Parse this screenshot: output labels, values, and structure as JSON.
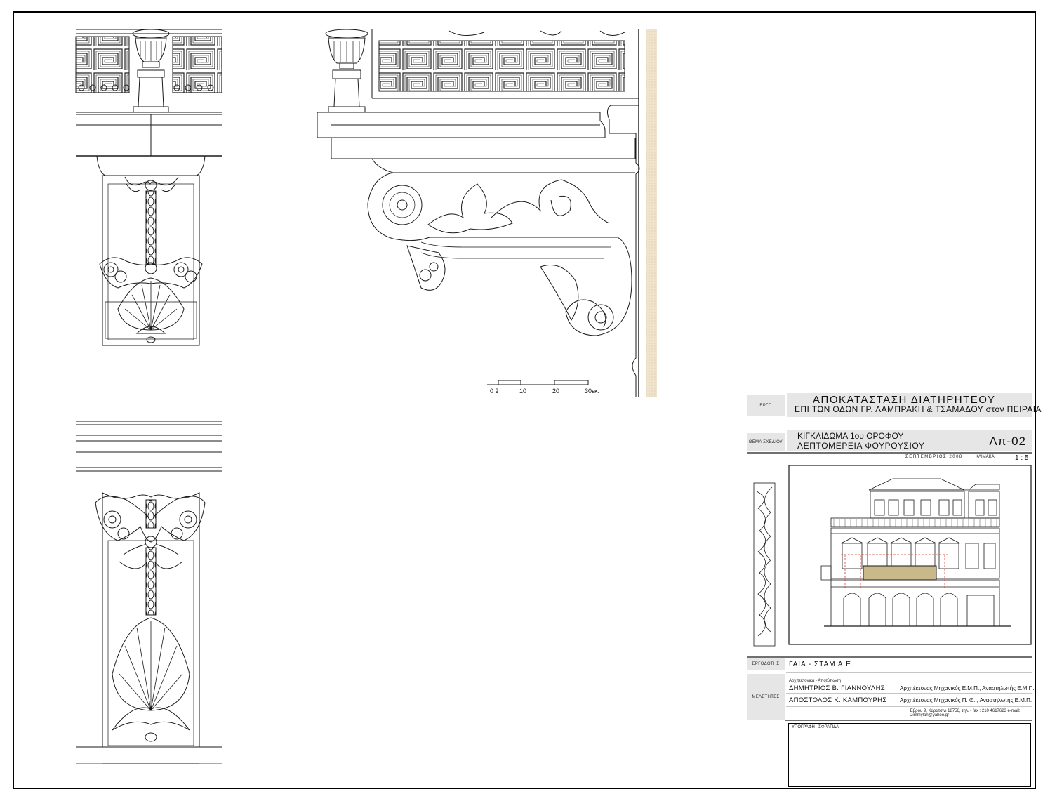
{
  "scale_bar": {
    "labels": [
      "0 2",
      "10",
      "20",
      "30εκ."
    ]
  },
  "title_block": {
    "project_label": "ΕΡΓΟ",
    "project_line1": "ΑΠΟΚΑΤΑΣΤΑΣΗ ΔΙΑΤΗΡΗΤΕΟΥ",
    "project_line2": "ΕΠΙ ΤΩΝ ΟΔΩΝ ΓΡ. ΛΑΜΠΡΑΚΗ & ΤΣΑΜΑΔΟΥ στον ΠΕΙΡΑΙΑ",
    "subject_label": "ΘΕΜΑ ΣΧΕΔΙΟΥ",
    "subject_line1": "ΚΙΓΚΛΙΔΩΜΑ 1ου ΟΡΟΦΟΥ",
    "subject_line2": "ΛΕΠΤΟΜΕΡΕΙΑ ΦΟΥΡΟΥΣΙΟΥ",
    "drawing_code": "Λπ-02",
    "date": "ΣΕΠΤΕΜΒΡΙΟΣ 2008",
    "scale_label": "ΚΛΙΜΑΚΑ",
    "scale_value": "1 : 5",
    "client_label": "ΕΡΓΟΔΟΤΗΣ",
    "client": "ΓΑΙΑ - ΣΤΑΜ Α.Ε.",
    "designers_label": "ΜΕΛΕΤΗΤΕΣ",
    "designers_sub": "Αρχιτεκτονικά - Αποτύπωση",
    "designer1_name": "ΔΗΜΗΤΡΙΟΣ Β. ΓΙΑΝΝΟΥΛΗΣ",
    "designer1_title": "Αρχιτέκτονας Μηχανικός Ε.Μ.Π., Αναστηλωτής Ε.Μ.Π.",
    "designer2_name": "ΑΠΟΣΤΟΛΟΣ Κ. ΚΑΜΠΟΥΡΗΣ",
    "designer2_title": "Αρχιτέκτονας Μηχανικός Π. Θ. , Αναστηλωτής Ε.Μ.Π.",
    "address": "Έβρου 9, Καρατσίνι 18756, τηλ. - fax : 210 4617623 e-mail: Dimmylan@yahoo.gr",
    "signature_label": "ΥΠΟΓΡΑΦΗ - ΣΦΡΑΓΙΔΑ"
  },
  "colors": {
    "line": "#1a1a1a",
    "wall_hatch": "#efe3cc",
    "label_bg": "#e6e6e6",
    "railing_highlight": "#c9b98a",
    "marker_red": "#d43a2a"
  }
}
